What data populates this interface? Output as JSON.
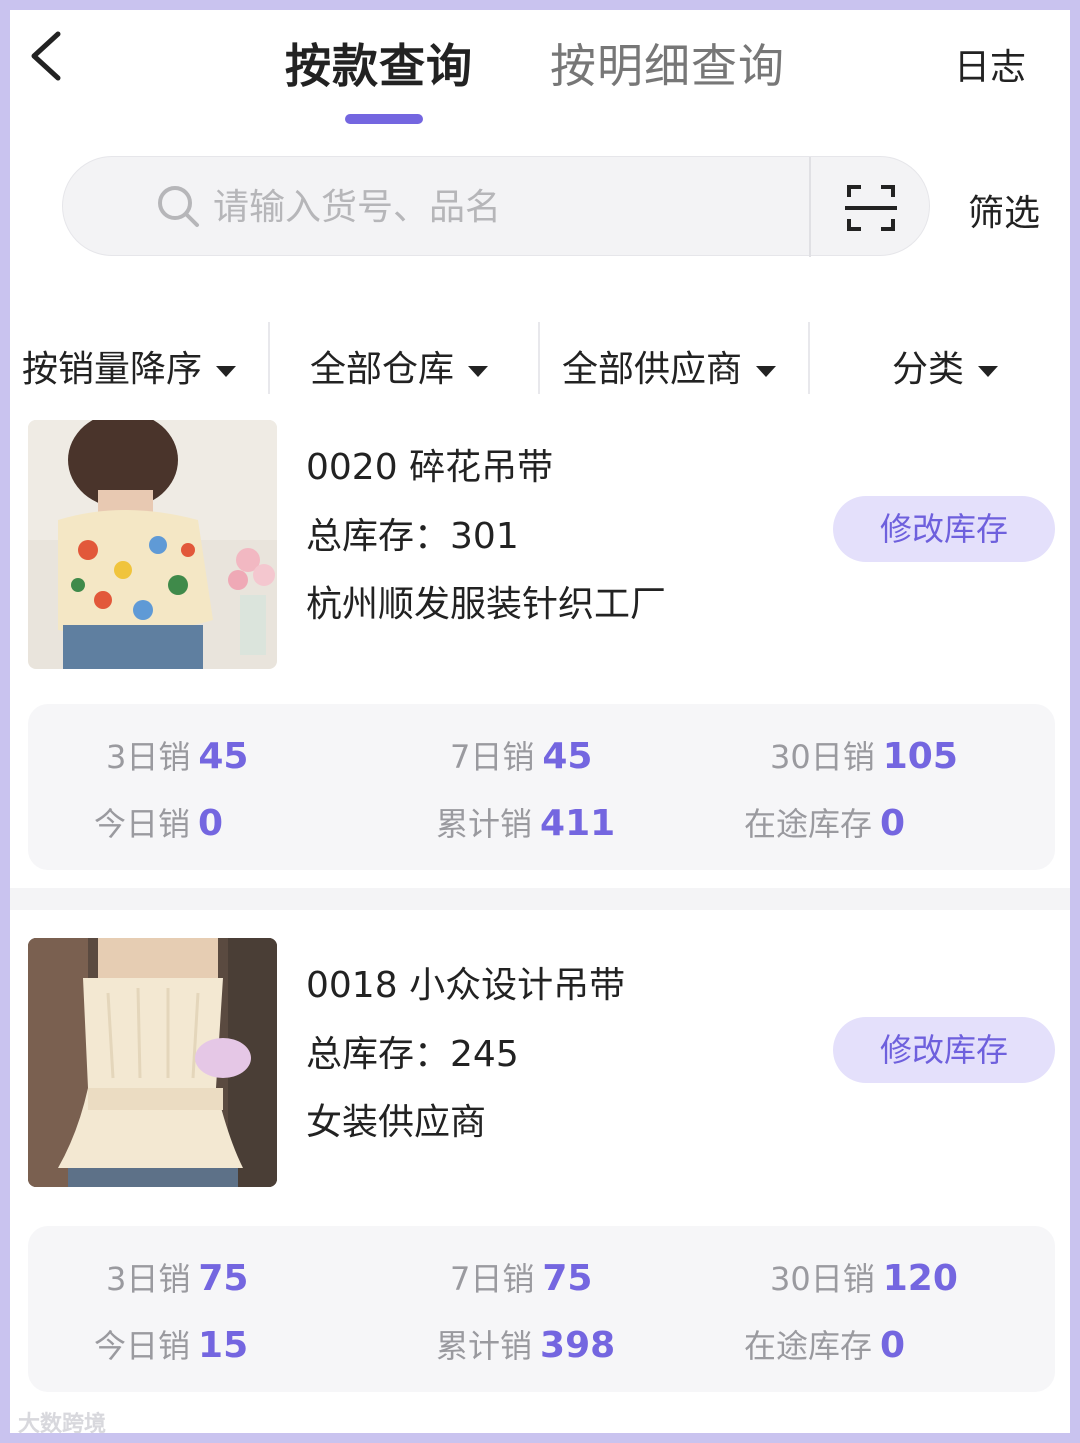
{
  "header": {
    "tabs": [
      {
        "label": "按款查询",
        "active": true
      },
      {
        "label": "按明细查询",
        "active": false
      }
    ],
    "log_label": "日志",
    "accent_color": "#7466e0"
  },
  "search": {
    "placeholder": "请输入货号、品名",
    "value": "",
    "filter_label": "筛选"
  },
  "filters": [
    {
      "label": "按销量降序"
    },
    {
      "label": "全部仓库"
    },
    {
      "label": "全部供应商"
    },
    {
      "label": "分类"
    }
  ],
  "products": [
    {
      "code": "0020",
      "name": "碎花吊带",
      "stock_label": "总库存：",
      "stock_value": "301",
      "supplier": "杭州顺发服装针织工厂",
      "edit_label": "修改库存",
      "stats": {
        "d3_label": "3日销",
        "d3_value": "45",
        "d7_label": "7日销",
        "d7_value": "45",
        "d30_label": "30日销",
        "d30_value": "105",
        "today_label": "今日销",
        "today_value": "0",
        "total_label": "累计销",
        "total_value": "411",
        "transit_label": "在途库存",
        "transit_value": "0"
      }
    },
    {
      "code": "0018",
      "name": "小众设计吊带",
      "stock_label": "总库存：",
      "stock_value": "245",
      "supplier": "女装供应商",
      "edit_label": "修改库存",
      "stats": {
        "d3_label": "3日销",
        "d3_value": "75",
        "d7_label": "7日销",
        "d7_value": "75",
        "d30_label": "30日销",
        "d30_value": "120",
        "today_label": "今日销",
        "today_value": "15",
        "total_label": "累计销",
        "total_value": "398",
        "transit_label": "在途库存",
        "transit_value": "0"
      }
    }
  ],
  "watermark": "大数跨境"
}
